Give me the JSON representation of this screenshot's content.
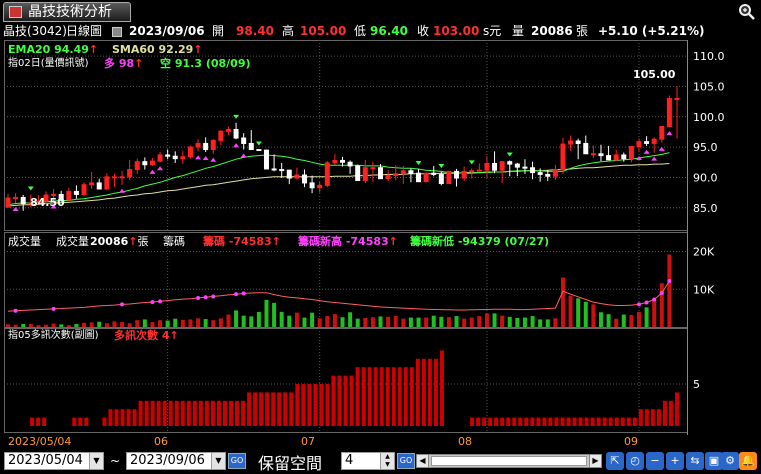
{
  "title": {
    "tab_label": "晶技技術分析",
    "stock_label": "晶技(3042)",
    "chart_type": "日線圖"
  },
  "quote": {
    "date": "2023/09/06",
    "open_label": "開",
    "open": "98.40",
    "high_label": "高",
    "high": "105.00",
    "low_label": "低",
    "low": "96.40",
    "close_label": "收",
    "close": "103.00",
    "unit": "s元",
    "vol_label": "量",
    "volume": "20086",
    "vol_unit": "張",
    "change": "+5.10 (+5.21%)"
  },
  "price_panel": {
    "ema": "EMA20 94.49",
    "sma": "SMA60 92.29",
    "ind_name": "指02日(量價訊號)",
    "bull_label": "多",
    "bull_val": "98",
    "bear_label": "空",
    "bear_val": "91.3",
    "range": "(08/09)",
    "hi_marker": "105.00",
    "lo_marker": "84.50"
  },
  "volume_panel": {
    "lbl1": "成交量",
    "lbl2": "成交量",
    "volume": "20086",
    "vol_unit": "張",
    "lbl3": "籌碼",
    "chip": "籌碼 -74583",
    "chip_high": "籌碼新高 -74583",
    "chip_low": "籌碼新低 -94379",
    "date": "(07/27)"
  },
  "signal_panel": {
    "title": "指05多訊次數(副圖)",
    "count": "多訊次數 4"
  },
  "x_axis": [
    "2023/05/04",
    "06",
    "07",
    "08",
    "09"
  ],
  "y_axis": {
    "price": [
      "110.0",
      "105.0",
      "100.0",
      "95.0",
      "90.0",
      "85.0"
    ],
    "volume": [
      "20K",
      "10K"
    ],
    "signal": [
      "5"
    ]
  },
  "bottom": {
    "from": "2023/05/04",
    "to": "2023/09/06",
    "tilde": "~",
    "go": "GO",
    "keep": "保留空間",
    "keep_value": "4"
  },
  "colors": {
    "up": "#ff2020",
    "down": "#ffffff",
    "ema": "#40ff40",
    "sma": "#e0e0a0",
    "bull": "#ff40ff",
    "bear": "#40ff40",
    "signal_bar": "#cc0000",
    "grid": "#555"
  },
  "icons": [
    "zoom-icon",
    "go-icon",
    "scroll-left-icon",
    "scroll-right-icon",
    "cursor-icon",
    "clock-icon",
    "zoom-out-icon",
    "zoom-in-icon",
    "move-icon",
    "fit-icon",
    "settings-icon",
    "alert-icon"
  ],
  "chart_data": {
    "type": "candlestick",
    "price_range": [
      82,
      111
    ],
    "candles": [
      [
        85.1,
        87.3,
        85.2
      ],
      [
        86.6,
        87.4,
        85.8
      ],
      [
        86.7,
        87.1,
        84.5
      ],
      [
        85.7,
        87.2,
        85.1
      ],
      [
        85.8,
        87.1,
        85.4
      ],
      [
        86.1,
        87.7,
        85.6
      ],
      [
        87.1,
        88.1,
        86.2
      ],
      [
        87.2,
        87.8,
        85.9
      ],
      [
        86.3,
        88.3,
        86.1
      ],
      [
        87.7,
        88.7,
        86.5
      ],
      [
        87.2,
        89.2,
        86.9
      ],
      [
        88.8,
        90.9,
        88.1
      ],
      [
        89.1,
        89.8,
        88.1
      ],
      [
        88.1,
        90.7,
        87.9
      ],
      [
        90.1,
        90.6,
        88.4
      ],
      [
        90.1,
        91.1,
        88.8
      ],
      [
        90.1,
        92.9,
        89.6
      ],
      [
        91.3,
        93.1,
        90.6
      ],
      [
        92.6,
        93.3,
        91.3
      ],
      [
        92.1,
        93.2,
        91.9
      ],
      [
        92.7,
        94.2,
        92.5
      ],
      [
        93.7,
        94.6,
        93.0
      ],
      [
        93.5,
        94.3,
        92.4
      ],
      [
        93.1,
        94.4,
        92.2
      ],
      [
        93.4,
        95.2,
        93.1
      ],
      [
        95.0,
        96.3,
        94.3
      ],
      [
        95.6,
        96.6,
        94.2
      ],
      [
        94.6,
        96.3,
        93.9
      ],
      [
        96.1,
        97.8,
        95.3
      ],
      [
        97.6,
        98.4,
        97.0
      ],
      [
        97.9,
        99.0,
        96.3
      ],
      [
        96.5,
        97.3,
        94.6
      ],
      [
        95.6,
        97.8,
        95.1
      ],
      [
        94.6,
        94.6,
        94.6
      ],
      [
        94.5,
        94.6,
        92.9
      ],
      [
        91.4,
        93.8,
        91.0
      ],
      [
        91.3,
        92.4,
        89.9
      ],
      [
        91.2,
        91.3,
        88.9
      ],
      [
        89.9,
        91.6,
        89.7
      ],
      [
        90.4,
        91.3,
        88.4
      ],
      [
        89.1,
        90.3,
        87.4
      ],
      [
        88.3,
        89.3,
        87.5
      ],
      [
        88.7,
        92.7,
        88.4
      ],
      [
        92.4,
        93.9,
        92.1
      ],
      [
        92.8,
        93.4,
        91.8
      ],
      [
        92.5,
        92.8,
        90.6
      ],
      [
        91.9,
        92.1,
        89.8
      ],
      [
        89.5,
        92.9,
        89.1
      ],
      [
        91.6,
        92.6,
        89.3
      ],
      [
        91.6,
        92.2,
        89.9
      ],
      [
        89.8,
        91.2,
        89.4
      ],
      [
        90.3,
        92.0,
        89.5
      ],
      [
        90.6,
        91.9,
        88.9
      ],
      [
        91.1,
        91.5,
        89.2
      ],
      [
        90.7,
        91.4,
        90.3
      ],
      [
        89.3,
        90.4,
        89.3
      ],
      [
        90.7,
        91.9,
        90.2
      ],
      [
        90.5,
        90.9,
        88.7
      ],
      [
        89.0,
        90.6,
        88.9
      ],
      [
        91.0,
        91.4,
        88.5
      ],
      [
        89.9,
        91.8,
        89.4
      ],
      [
        91.0,
        91.5,
        89.8
      ],
      [
        91.1,
        92.3,
        91.0
      ],
      [
        91.2,
        93.5,
        90.0
      ],
      [
        92.3,
        94.3,
        90.7
      ],
      [
        91.2,
        92.4,
        89.1
      ],
      [
        92.6,
        92.8,
        90.2
      ],
      [
        92.2,
        92.4,
        90.2
      ],
      [
        91.7,
        93.0,
        90.6
      ],
      [
        91.6,
        92.6,
        89.7
      ],
      [
        90.8,
        91.5,
        89.3
      ],
      [
        90.5,
        91.2,
        89.4
      ],
      [
        90.2,
        92.1,
        89.6
      ],
      [
        91.3,
        96.5,
        90.6
      ],
      [
        95.5,
        96.9,
        94.4
      ],
      [
        96.0,
        96.4,
        93.0
      ],
      [
        95.6,
        96.9,
        94.4
      ],
      [
        93.9,
        95.3,
        93.2
      ],
      [
        93.9,
        95.4,
        92.7
      ],
      [
        93.6,
        95.2,
        93.0
      ],
      [
        92.9,
        94.6,
        92.7
      ],
      [
        93.7,
        94.1,
        92.6
      ],
      [
        93.1,
        94.6,
        92.5
      ],
      [
        95.1,
        96.4,
        94.2
      ],
      [
        95.9,
        96.8,
        95.2
      ],
      [
        95.6,
        96.6,
        94.1
      ],
      [
        96.3,
        98.4,
        95.7
      ],
      [
        98.4,
        103.5,
        98.3
      ],
      [
        103.0,
        105.0,
        96.4
      ]
    ],
    "ema20": [
      85.5,
      85.7,
      85.8,
      85.8,
      85.9,
      86.0,
      86.1,
      86.2,
      86.2,
      86.4,
      86.5,
      86.7,
      86.9,
      87.1,
      87.4,
      87.6,
      87.9,
      88.2,
      88.6,
      88.9,
      89.2,
      89.6,
      90.0,
      90.3,
      90.7,
      91.1,
      91.5,
      91.8,
      92.2,
      92.6,
      93.0,
      93.3,
      93.5,
      93.6,
      93.7,
      93.6,
      93.5,
      93.3,
      93.0,
      92.8,
      92.5,
      92.2,
      92.0,
      92.0,
      92.0,
      92.0,
      92.0,
      91.9,
      91.9,
      91.9,
      91.7,
      91.6,
      91.5,
      91.5,
      91.4,
      91.2,
      91.1,
      91.0,
      90.8,
      90.8,
      90.7,
      90.7,
      90.8,
      90.8,
      90.9,
      90.9,
      91.0,
      91.1,
      91.1,
      91.1,
      91.1,
      91.0,
      91.0,
      91.0,
      91.5,
      91.9,
      92.2,
      92.4,
      92.6,
      92.7,
      92.8,
      92.9,
      93.0,
      93.2,
      93.4,
      93.6,
      93.8,
      94.1
    ],
    "sma60": [
      85.3,
      85.4,
      85.5,
      85.5,
      85.6,
      85.7,
      85.8,
      85.8,
      85.9,
      86.0,
      86.1,
      86.2,
      86.3,
      86.5,
      86.6,
      86.8,
      87.0,
      87.1,
      87.3,
      87.4,
      87.6,
      87.8,
      87.9,
      88.1,
      88.3,
      88.5,
      88.7,
      88.8,
      89.0,
      89.2,
      89.4,
      89.6,
      89.8,
      89.9,
      90.0,
      90.1,
      90.1,
      90.1,
      90.1,
      90.1,
      90.1,
      90.1,
      90.1,
      90.2,
      90.2,
      90.2,
      90.3,
      90.3,
      90.4,
      90.4,
      90.5,
      90.5,
      90.5,
      90.6,
      90.6,
      90.6,
      90.6,
      90.7,
      90.7,
      90.7,
      90.8,
      90.8,
      90.8,
      90.9,
      90.9,
      90.9,
      91.0,
      91.0,
      91.1,
      91.1,
      91.1,
      91.2,
      91.3,
      91.3,
      91.4,
      91.5,
      91.6,
      91.6,
      91.7,
      91.8,
      91.9,
      92.0,
      92.0,
      92.1,
      92.1,
      92.2,
      92.2,
      92.3
    ],
    "volume": [
      700,
      600,
      800,
      800,
      500,
      600,
      900,
      700,
      500,
      800,
      1100,
      1200,
      1400,
      1000,
      1500,
      1300,
      1000,
      1800,
      2000,
      1300,
      1800,
      1700,
      2200,
      1900,
      2000,
      2300,
      2100,
      1800,
      2300,
      3300,
      4400,
      3000,
      2800,
      4000,
      7200,
      6400,
      4000,
      3000,
      3800,
      2500,
      3800,
      2300,
      2900,
      3400,
      2600,
      3900,
      2200,
      2400,
      2600,
      2800,
      2700,
      2900,
      2200,
      2500,
      2500,
      2500,
      3000,
      2700,
      2600,
      2900,
      2200,
      2500,
      2900,
      3600,
      3600,
      3000,
      2700,
      2400,
      2500,
      2900,
      2000,
      2000,
      2300,
      13100,
      8300,
      7600,
      6700,
      6000,
      3900,
      3400,
      2200,
      3300,
      3200,
      4000,
      5200,
      7300,
      11600,
      19200
    ],
    "chip_line": [
      4200,
      4300,
      4400,
      4500,
      4600,
      4700,
      4800,
      4900,
      5000,
      5100,
      5200,
      5400,
      5600,
      5700,
      5800,
      6000,
      6100,
      6300,
      6500,
      6600,
      6800,
      7000,
      7200,
      7400,
      7500,
      7700,
      7900,
      8100,
      8300,
      8500,
      8700,
      8900,
      9000,
      9100,
      9100,
      8600,
      8200,
      7900,
      7700,
      7500,
      7300,
      7000,
      6700,
      6500,
      6300,
      6100,
      5900,
      5700,
      5500,
      5300,
      5200,
      5100,
      5000,
      4900,
      4800,
      4700,
      4650,
      4600,
      4550,
      4500,
      4500,
      4550,
      4600,
      4650,
      4700,
      4700,
      4700,
      4600,
      4600,
      4700,
      4800,
      4900,
      5000,
      9500,
      8700,
      8000,
      7300,
      6600,
      6200,
      5900,
      5700,
      5700,
      5800,
      6000,
      6500,
      7300,
      9000,
      12200
    ],
    "volume_range": [
      0,
      22000
    ],
    "signal_count": [
      0,
      0,
      0,
      0,
      1,
      1,
      1,
      0,
      0,
      0,
      0,
      1,
      1,
      1,
      0,
      0,
      1,
      2,
      2,
      2,
      2,
      2,
      3,
      3,
      3,
      3,
      3,
      3,
      3,
      3,
      3,
      3,
      3,
      3,
      3,
      3,
      3,
      3,
      3,
      3,
      4,
      4,
      4,
      4,
      4,
      4,
      4,
      4,
      5,
      5,
      5,
      5,
      5,
      5,
      6,
      6,
      6,
      6,
      7,
      7,
      7,
      7,
      7,
      7,
      7,
      7,
      7,
      7,
      8,
      8,
      8,
      8,
      9,
      0,
      0,
      0,
      0,
      1,
      1,
      1,
      1,
      1,
      1,
      1,
      1,
      1,
      1,
      1,
      1,
      1,
      1,
      1,
      1,
      1,
      1,
      1,
      1,
      1,
      1,
      1,
      1,
      1,
      1,
      1,
      1,
      2,
      2,
      2,
      2,
      3,
      3,
      4
    ],
    "signal_range": [
      0,
      10
    ],
    "bull_signals": [
      1,
      6,
      15,
      19,
      20,
      25,
      26,
      27,
      30,
      31,
      83,
      84,
      85,
      86,
      87
    ],
    "bear_signals": [
      3,
      30,
      33,
      54,
      57,
      61,
      66
    ]
  }
}
